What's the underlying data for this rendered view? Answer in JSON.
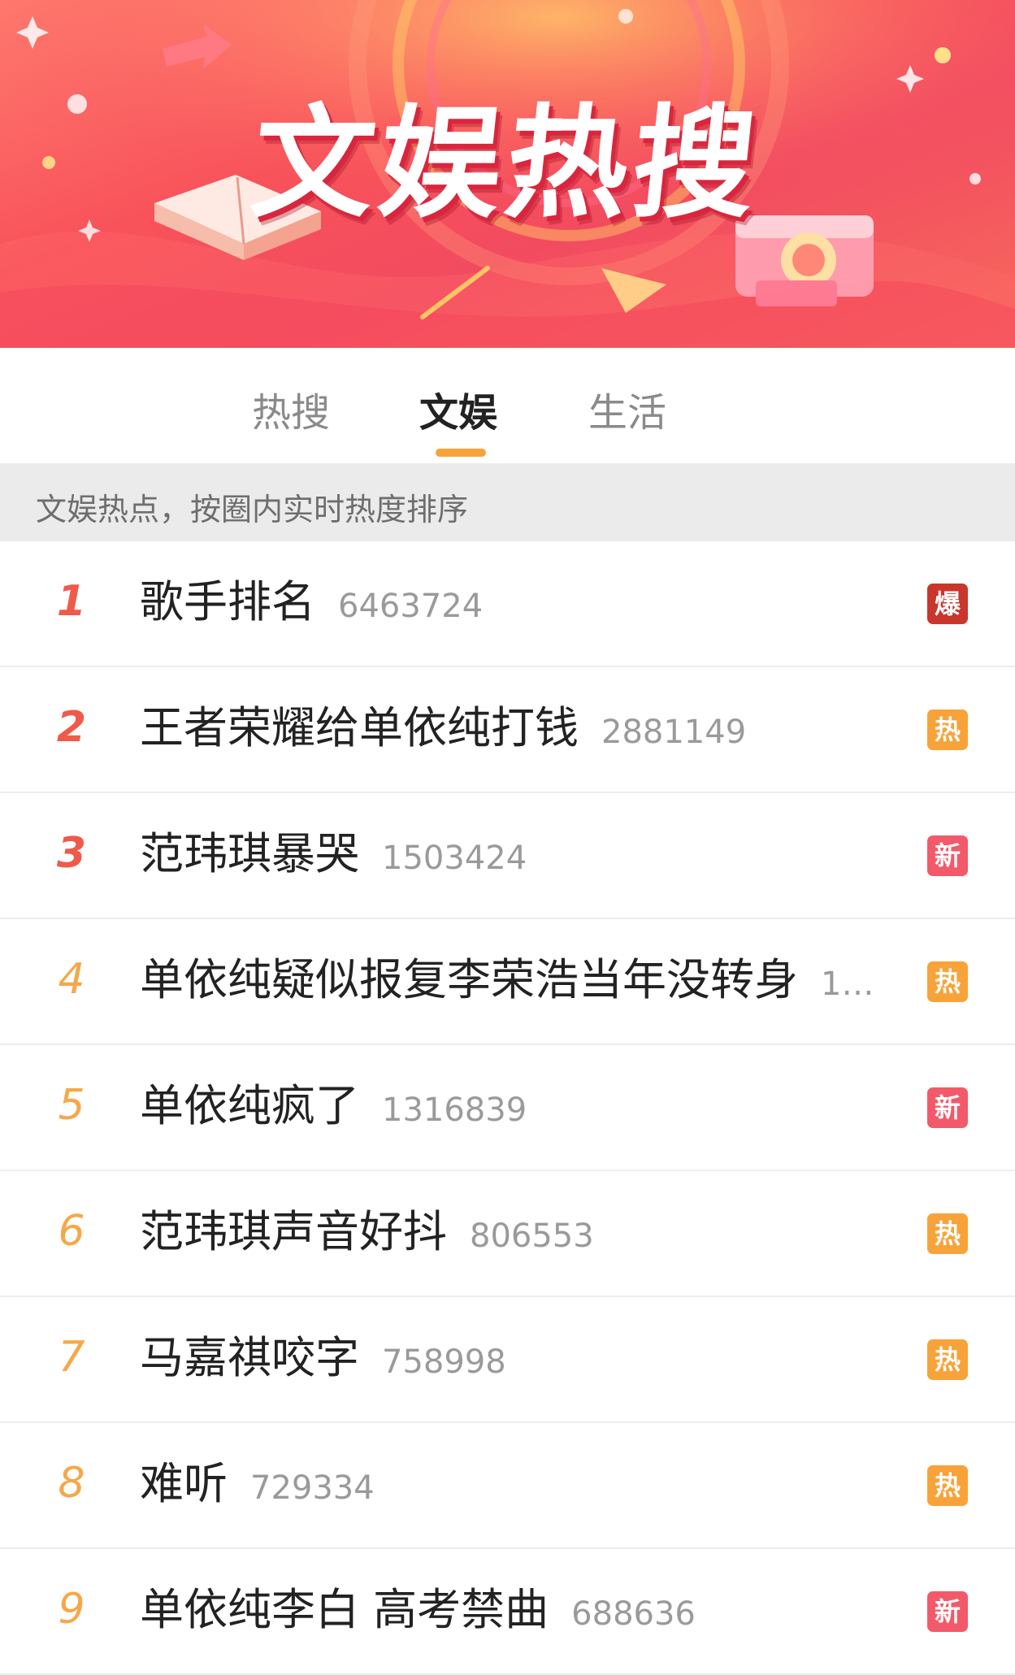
{
  "banner": {
    "title": "文娱热搜"
  },
  "tabs": [
    {
      "label": "热搜",
      "active": false
    },
    {
      "label": "文娱",
      "active": true
    },
    {
      "label": "生活",
      "active": false
    }
  ],
  "subheader": "文娱热点，按圈内实时热度排序",
  "colors": {
    "accent": "#f7a33a",
    "badge_bao": "#c9362c",
    "badge_re": "#f7a33a",
    "badge_xin": "#f25a6a",
    "rank_top": "#f05a4a",
    "rank_normal": "#f5a84a"
  },
  "list": [
    {
      "rank": "1",
      "title": "歌手排名",
      "count": "6463724",
      "badge": "爆",
      "badge_type": "bao"
    },
    {
      "rank": "2",
      "title": "王者荣耀给单依纯打钱",
      "count": "2881149",
      "badge": "热",
      "badge_type": "re"
    },
    {
      "rank": "3",
      "title": "范玮琪暴哭",
      "count": "1503424",
      "badge": "新",
      "badge_type": "xin"
    },
    {
      "rank": "4",
      "title": "单依纯疑似报复李荣浩当年没转身",
      "count": "1…",
      "badge": "热",
      "badge_type": "re"
    },
    {
      "rank": "5",
      "title": "单依纯疯了",
      "count": "1316839",
      "badge": "新",
      "badge_type": "xin"
    },
    {
      "rank": "6",
      "title": "范玮琪声音好抖",
      "count": "806553",
      "badge": "热",
      "badge_type": "re"
    },
    {
      "rank": "7",
      "title": "马嘉祺咬字",
      "count": "758998",
      "badge": "热",
      "badge_type": "re"
    },
    {
      "rank": "8",
      "title": "难听",
      "count": "729334",
      "badge": "热",
      "badge_type": "re"
    },
    {
      "rank": "9",
      "title": "单依纯李白 高考禁曲",
      "count": "688636",
      "badge": "新",
      "badge_type": "xin"
    }
  ]
}
